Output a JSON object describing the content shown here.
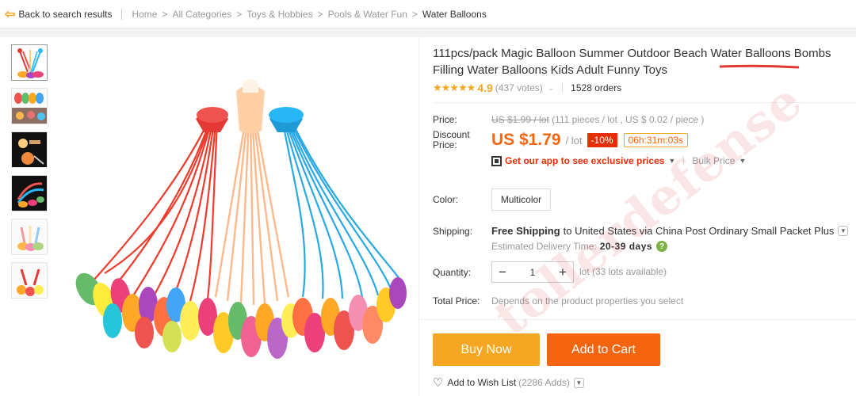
{
  "nav": {
    "back_label": "Back to search results",
    "breadcrumbs": [
      "Home",
      "All Categories",
      "Toys & Hobbies",
      "Pools & Water Fun",
      "Water Balloons"
    ],
    "separator": ">"
  },
  "product": {
    "title": "111pcs/pack Magic Balloon Summer Outdoor Beach Water Balloons Bombs Filling Water Balloons Kids Adult Funny Toys",
    "rating": "4.9",
    "votes": "(437 votes)",
    "orders": "1528 orders",
    "stars": "★★★★★"
  },
  "price": {
    "price_label": "Price:",
    "original": "US $1.99 / lot",
    "original_note": "(111 pieces / lot , US $ 0.02 / piece )",
    "discount_label_1": "Discount",
    "discount_label_2": "Price:",
    "current": "US $1.79",
    "unit": "/ lot",
    "discount_badge": "-10%",
    "timer": "06h:31m:03s",
    "app_promo": "Get our app to see exclusive prices",
    "bulk_price": "Bulk Price"
  },
  "options": {
    "color_label": "Color:",
    "color_value": "Multicolor",
    "shipping_label": "Shipping:",
    "shipping_free": "Free Shipping",
    "shipping_text": "to United States via China Post Ordinary Small Packet Plus",
    "delivery_label": "Estimated Delivery Time:",
    "delivery_days": "20-39 days",
    "quantity_label": "Quantity:",
    "quantity_value": "1",
    "quantity_note": "lot (33 lots available)",
    "total_label": "Total Price:",
    "total_value": "Depends on the product properties you select"
  },
  "actions": {
    "buy_now": "Buy Now",
    "add_to_cart": "Add to Cart",
    "wishlist": "Add to Wish List",
    "wishlist_adds": "(2286 Adds)"
  },
  "watermark": "tollerdefense",
  "colors": {
    "accent_orange": "#f5a623",
    "cart_orange": "#f5650f",
    "discount_red": "#e62e04",
    "star": "#f5a623"
  }
}
